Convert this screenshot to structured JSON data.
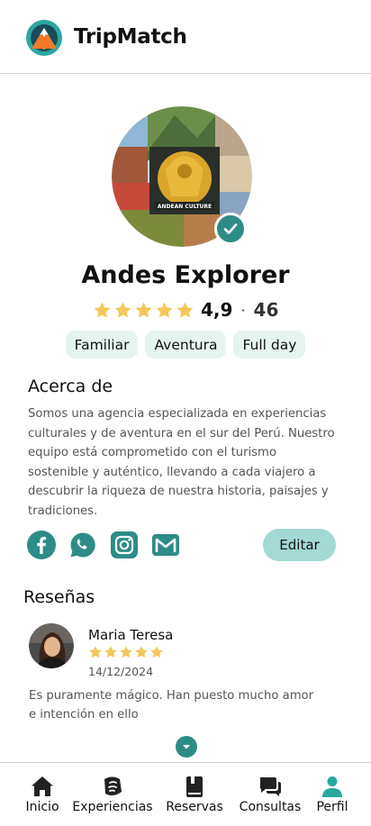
{
  "app": {
    "title": "TripMatch"
  },
  "profile": {
    "name": "Andes Explorer",
    "avatar_caption": "ANDEAN CULTURE",
    "rating": "4,9",
    "separator": "·",
    "review_count": "46",
    "stars": 5,
    "tags": [
      "Familiar",
      "Aventura",
      "Full day"
    ]
  },
  "about": {
    "title": "Acerca de",
    "text": "Somos una agencia especializada en experiencias culturales y de aventura en el sur del Perú. Nuestro equipo está comprometido con el turismo sostenible y auténtico, llevando a cada viajero a descubrir la riqueza de nuestra historia, paisajes y tradiciones."
  },
  "socials": [
    "facebook-icon",
    "whatsapp-icon",
    "instagram-icon",
    "gmail-icon"
  ],
  "actions": {
    "edit_label": "Editar"
  },
  "reviews": {
    "title": "Reseñas",
    "items": [
      {
        "name": "Maria Teresa",
        "stars": 5,
        "date": "14/12/2024",
        "text": "Es puramente mágico. Han puesto mucho amor e intención en ello"
      }
    ]
  },
  "nav": {
    "items": [
      {
        "label": "Inicio",
        "icon": "home-icon"
      },
      {
        "label": "Experiencias",
        "icon": "experiences-icon"
      },
      {
        "label": "Reservas",
        "icon": "book-icon"
      },
      {
        "label": "Consultas",
        "icon": "chat-icon"
      },
      {
        "label": "Perfil",
        "icon": "user-icon",
        "active": true
      }
    ]
  },
  "colors": {
    "accent": "#2e8c86",
    "star": "#f5c75a",
    "tag_bg": "#e6f4f1",
    "button_bg": "#a3d9d4"
  }
}
